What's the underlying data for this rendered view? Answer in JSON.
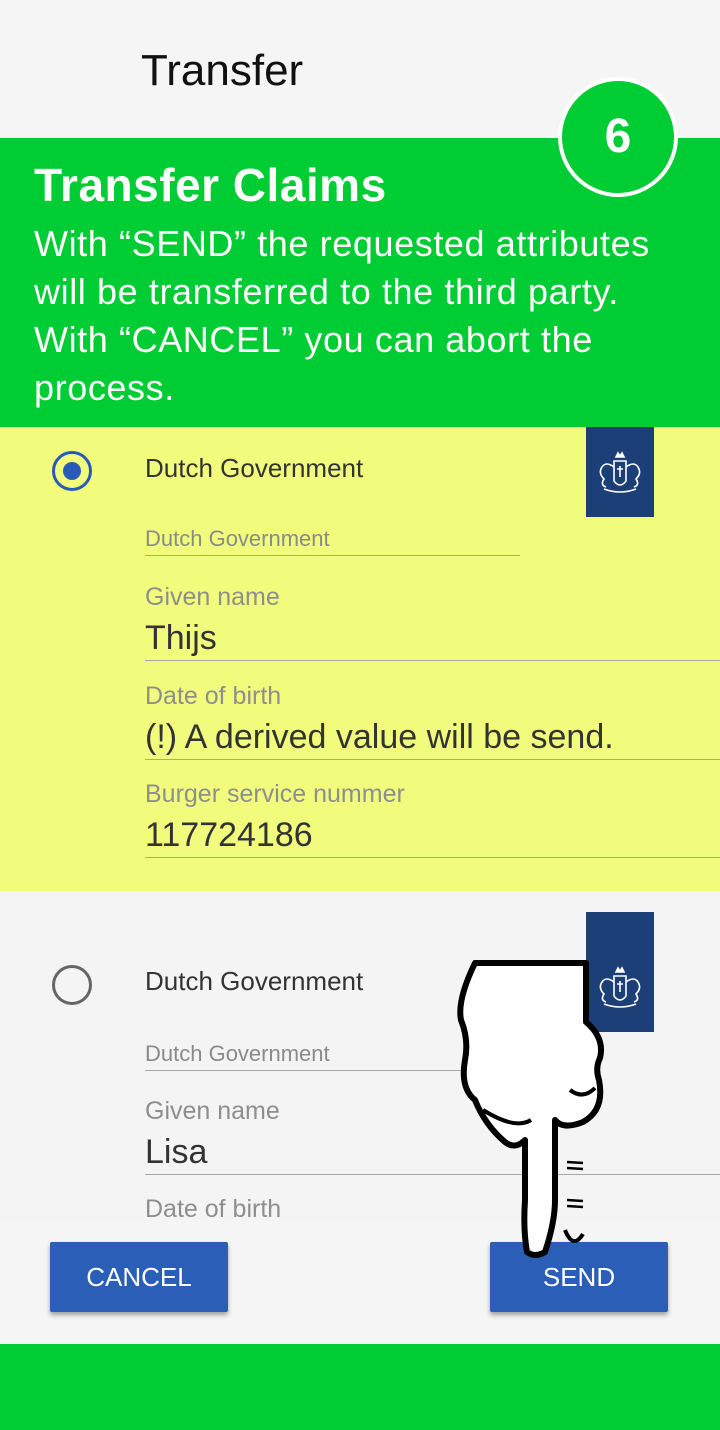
{
  "app_bar": {
    "title": "Transfer"
  },
  "banner": {
    "step": "6",
    "title": "Transfer Claims",
    "text": "With “SEND” the requested attributes will be transferred to the third party. With “CANCEL” you can abort the process."
  },
  "cards": [
    {
      "selected": true,
      "issuer": "Dutch Government",
      "issuer_field": "Dutch Government",
      "fields": [
        {
          "label": "Given name",
          "value": "Thijs"
        },
        {
          "label": "Date of birth",
          "value": "(!) A derived value will be send."
        },
        {
          "label": "Burger service nummer",
          "value": "117724186"
        }
      ]
    },
    {
      "selected": false,
      "issuer": "Dutch Government",
      "issuer_field": "Dutch Government",
      "fields": [
        {
          "label": "Given name",
          "value": "Lisa"
        },
        {
          "label": "Date of birth",
          "value": ""
        }
      ]
    }
  ],
  "actions": {
    "cancel_label": "CANCEL",
    "send_label": "SEND"
  },
  "colors": {
    "accent_green": "#00cc33",
    "highlight_yellow": "#f2fc7c",
    "button_blue": "#2b5fb7",
    "logo_navy": "#1c3f77"
  },
  "icons": {
    "logo": "dutch-coat-of-arms-icon",
    "pointer": "pointing-hand-icon"
  }
}
